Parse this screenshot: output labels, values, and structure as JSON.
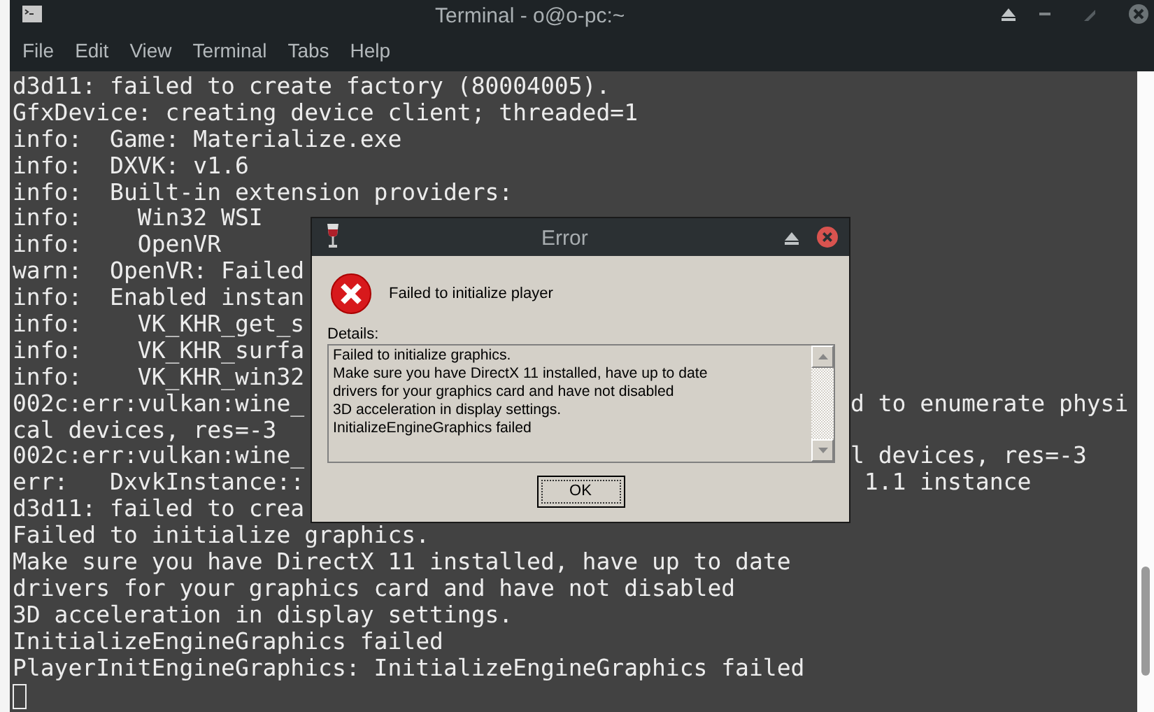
{
  "window": {
    "title": "Terminal - o@o-pc:~"
  },
  "menu": [
    "File",
    "Edit",
    "View",
    "Terminal",
    "Tabs",
    "Help"
  ],
  "terminal_lines": [
    {
      "text": "d3d11: failed to create factory (80004005)."
    },
    {
      "text": "GfxDevice: creating device client; threaded=1"
    },
    {
      "text": "info:  Game: Materialize.exe"
    },
    {
      "text": "info:  DXVK: v1.6"
    },
    {
      "text": "info:  Built-in extension providers:"
    },
    {
      "text": "info:    Win32 WSI"
    },
    {
      "text": "info:    OpenVR"
    },
    {
      "text": "warn:  OpenVR: Failed"
    },
    {
      "text": "info:  Enabled instan"
    },
    {
      "text": "info:    VK_KHR_get_s"
    },
    {
      "text": "info:    VK_KHR_surfa"
    },
    {
      "text": "info:    VK_KHR_win32"
    },
    {
      "text": "002c:err:vulkan:wine_",
      "right": "d to enumerate physi"
    },
    {
      "text": "cal devices, res=-3"
    },
    {
      "text": "002c:err:vulkan:wine_",
      "right": "l devices, res=-3"
    },
    {
      "text": "err:   DxvkInstance::",
      "right": " 1.1 instance"
    },
    {
      "text": "d3d11: failed to crea"
    },
    {
      "text": "Failed to initialize graphics."
    },
    {
      "text": "Make sure you have DirectX 11 installed, have up to date"
    },
    {
      "text": "drivers for your graphics card and have not disabled"
    },
    {
      "text": "3D acceleration in display settings."
    },
    {
      "text": "InitializeEngineGraphics failed"
    },
    {
      "text": "PlayerInitEngineGraphics: InitializeEngineGraphics failed"
    }
  ],
  "dialog": {
    "title": "Error",
    "message": "Failed to initialize player",
    "details_label": "Details:",
    "details": [
      "Failed to initialize graphics.",
      "Make sure you have DirectX 11 installed, have up to date",
      "drivers for your graphics card and have not disabled",
      "3D acceleration in display settings.",
      "InitializeEngineGraphics failed"
    ],
    "button": "OK"
  }
}
